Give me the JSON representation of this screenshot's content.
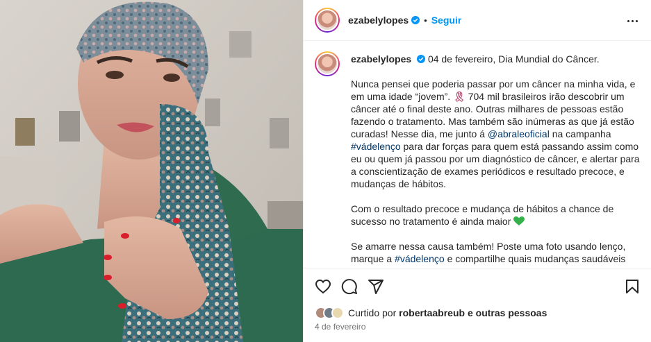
{
  "post": {
    "username": "ezabelylopes",
    "separator": "•",
    "follow_label": "Seguir"
  },
  "caption": {
    "username": "ezabelylopes",
    "first_line": "04 de fevereiro, Dia Mundial do Câncer.",
    "p1_a": "Nunca pensei que poderia passar por um câncer na minha vida, e em uma idade “jovem”.",
    "p1_ribbon": "🎗",
    "p1_b": "704 mil brasileiros irão descobrir um câncer até o final deste ano. Outras milhares de pessoas estão fazendo o tratamento. Mas também são inúmeras as que já estão curadas! Nesse dia, me junto á",
    "mention": "@abraleoficial",
    "p1_c": "na campanha",
    "hashtag1": "#vádelenço",
    "p1_d": "para dar forças para quem está passando assim como eu ou quem já passou por um diagnóstico de câncer, e alertar para a conscientização de exames periódicos e resultado precoce, e mudanças de hábitos.",
    "p2": "Com o resultado precoce e mudança de hábitos a chance de sucesso no tratamento é ainda maior",
    "p3_a": "Se amarre nessa causa também! Poste uma foto usando lenço, marque a",
    "hashtag2": "#vádelenço",
    "p3_b": "e compartilhe quais mudanças saudáveis"
  },
  "likes": {
    "prefix": "Curtido por",
    "user": "robertaabreub",
    "suffix": "e outras pessoas"
  },
  "date": "4 de fevereiro",
  "icons": {
    "like": "heart-icon",
    "comment": "comment-icon",
    "share": "share-icon",
    "save": "bookmark-icon",
    "verified": "verified-badge-icon",
    "more": "more-options-icon"
  },
  "colors": {
    "follow": "#0095f6",
    "link": "#00376b",
    "verified": "#0095f6",
    "muted": "#737373"
  }
}
